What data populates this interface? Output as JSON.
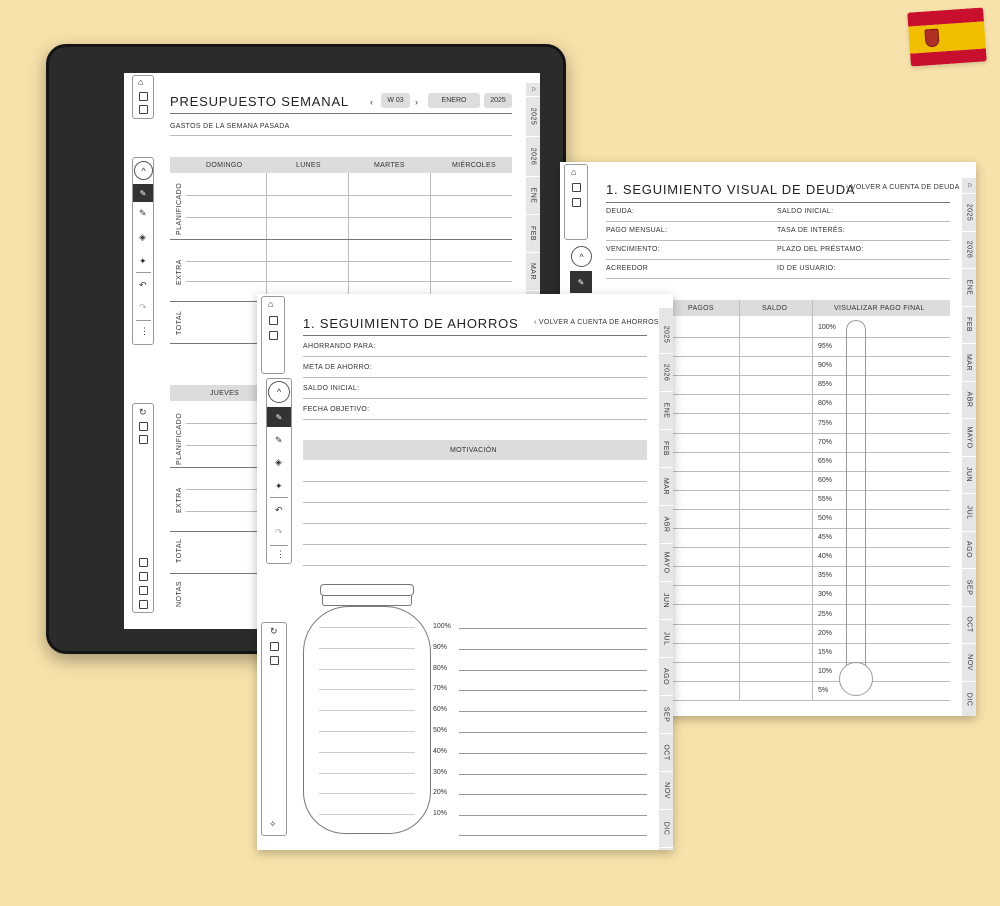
{
  "weekly": {
    "title": "PRESUPUESTO SEMANAL",
    "week": "W 03",
    "month": "ENERO",
    "year": "2025",
    "subtitle": "GASTOS DE LA SEMANA PASADA",
    "days_top": [
      "DOMINGO",
      "LUNES",
      "MARTES",
      "MIÉRCOLES"
    ],
    "day_bottom": "JUEVES",
    "rows": [
      "PLANIFICADO",
      "EXTRA",
      "TOTAL",
      "NOTAS"
    ],
    "tabs": [
      "2025",
      "2026",
      "ENE",
      "FEB",
      "MAR"
    ]
  },
  "debt": {
    "title": "1. SEGUIMIENTO VISUAL DE DEUDA",
    "back": "VOLVER A CUENTA DE DEUDA",
    "fields_left": [
      "DEUDA:",
      "PAGO MENSUAL:",
      "VENCIMIENTO:",
      "ACREEDOR"
    ],
    "fields_right": [
      "SALDO INICIAL:",
      "TASA DE INTERÉS:",
      "PLAZO DEL PRÉSTAMO:",
      "ID DE USUARIO:"
    ],
    "columns": [
      "PAGOS",
      "SALDO",
      "VISUALIZAR PAGO FINAL"
    ],
    "percents": [
      "100%",
      "95%",
      "90%",
      "85%",
      "80%",
      "75%",
      "70%",
      "65%",
      "60%",
      "55%",
      "50%",
      "45%",
      "40%",
      "35%",
      "30%",
      "25%",
      "20%",
      "15%",
      "10%",
      "5%"
    ],
    "tabs": [
      "2025",
      "2026",
      "ENE",
      "FEB",
      "MAR",
      "ABR",
      "MAYO",
      "JUN",
      "JUL",
      "AGO",
      "SEP",
      "OCT",
      "NOV",
      "DIC"
    ]
  },
  "savings": {
    "title": "1. SEGUIMIENTO DE AHORROS",
    "back": "VOLVER A CUENTA DE AHORROS",
    "fields": [
      "AHORRANDO PARA:",
      "META DE AHORRO:",
      "SALDO INICIAL:",
      "FECHA OBJETIVO:"
    ],
    "motivation": "MOTIVACIÓN",
    "percents": [
      "100%",
      "90%",
      "80%",
      "70%",
      "60%",
      "50%",
      "40%",
      "30%",
      "20%",
      "10%"
    ],
    "tabs": [
      "2025",
      "2026",
      "ENE",
      "FEB",
      "MAR",
      "ABR",
      "MAYO",
      "JUN",
      "JUL",
      "AGO",
      "SEP",
      "OCT",
      "NOV",
      "DIC"
    ]
  },
  "colors": {
    "background": "#f8e2ab",
    "flag_red": "#c8102e",
    "flag_yellow": "#f1bf00",
    "device": "#2b2b2b"
  }
}
